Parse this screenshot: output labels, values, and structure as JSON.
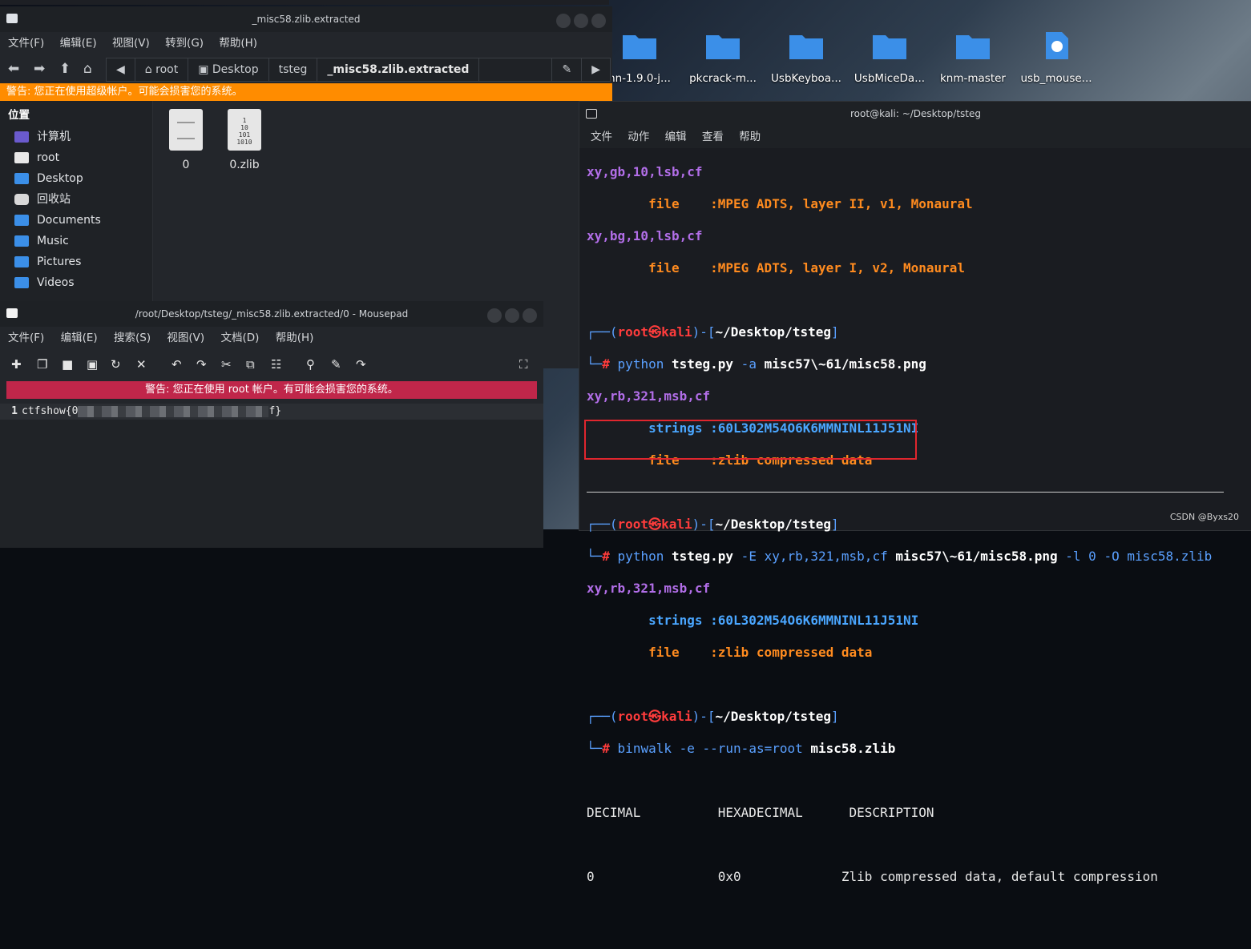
{
  "file_manager": {
    "title": "_misc58.zlib.extracted",
    "menu": [
      "文件(F)",
      "编辑(E)",
      "视图(V)",
      "转到(G)",
      "帮助(H)"
    ],
    "breadcrumbs": [
      "root",
      "Desktop",
      "tsteg",
      "_misc58.zlib.extracted"
    ],
    "warning": "警告: 您正在使用超级帐户。可能会损害您的系统。",
    "sidebar_heading": "位置",
    "sidebar_items": [
      "计算机",
      "root",
      "Desktop",
      "回收站",
      "Documents",
      "Music",
      "Pictures",
      "Videos"
    ],
    "files": [
      "0",
      "0.zlib"
    ],
    "file_icon_binary_text": "1\n10\n101\n1010"
  },
  "desktop": {
    "icons": [
      "hn-1.9.0-j...",
      "pkcrack-m...",
      "UsbKeyboa...",
      "UsbMiceDa...",
      "knm-master",
      "usb_mouse..."
    ]
  },
  "mousepad": {
    "title": "/root/Desktop/tsteg/_misc58.zlib.extracted/0 - Mousepad",
    "menu": [
      "文件(F)",
      "编辑(E)",
      "搜索(S)",
      "视图(V)",
      "文档(D)",
      "帮助(H)"
    ],
    "warning": "警告: 您正在使用 root 帐户。有可能会损害您的系统。",
    "line_number": "1",
    "content_prefix": "ctfshow{0",
    "content_suffix": "f}"
  },
  "terminal": {
    "title": "root@kali: ~/Desktop/tsteg",
    "menu": [
      "文件",
      "动作",
      "编辑",
      "查看",
      "帮助"
    ],
    "l1": "xy,gb,10,lsb,cf",
    "l2_key": "file",
    "l2_val": ":MPEG ADTS, layer II, v1, Monaural",
    "l3": "xy,bg,10,lsb,cf",
    "l4_key": "file",
    "l4_val": ":MPEG ADTS, layer I, v2, Monaural",
    "p_user": "root",
    "p_skull": "㉿",
    "p_host": "kali",
    "p_path": "~/Desktop/tsteg",
    "cmd1_a": "python ",
    "cmd1_b": "tsteg.py",
    "cmd1_c": " -a ",
    "cmd1_d": "misc57\\~61/misc58.png",
    "l7": "xy,rb,321,msb,cf",
    "strings_key": "strings",
    "strings_val": ":60L302M54O6K6MMNINL11J51NI",
    "file_key": "file",
    "file_val": ":zlib compressed data",
    "cmd2_a": "python ",
    "cmd2_b": "tsteg.py",
    "cmd2_c": " -E xy,rb,321,msb,cf ",
    "cmd2_d": "misc57\\~61/misc58.png",
    "cmd2_e": " -l 0 -O misc58.zlib",
    "cmd3_a": "binwalk",
    "cmd3_b": " -e --run-as=root ",
    "cmd3_c": "misc58.zlib",
    "bw_headers": [
      "DECIMAL",
      "HEXADECIMAL",
      "DESCRIPTION"
    ],
    "bw_row": [
      "0",
      "0x0",
      "Zlib compressed data, default compression"
    ],
    "watermark": "CSDN @Byxs20"
  },
  "colors": {
    "warning_orange": "#ff8c00",
    "warning_red": "#c0264a",
    "highlight_box": "#e0262e",
    "prompt_blue": "#4aa6ff",
    "kali_purple": "#b26ee8"
  }
}
